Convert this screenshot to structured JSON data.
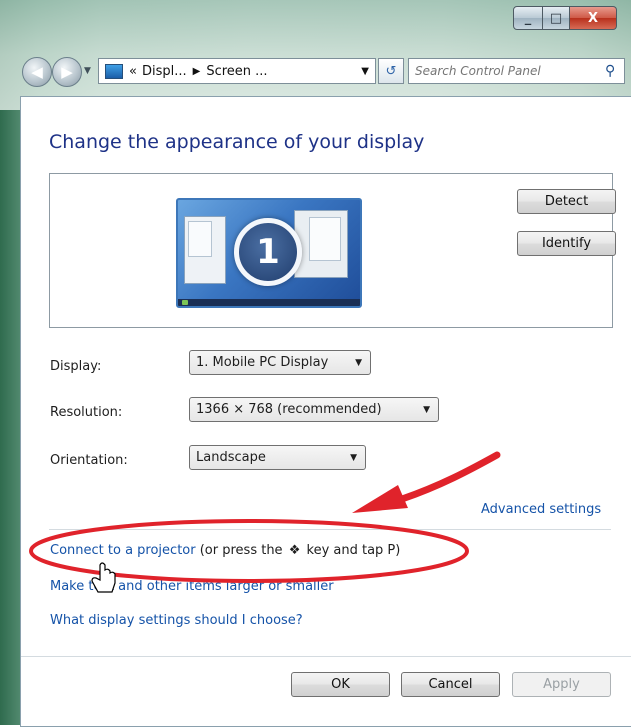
{
  "window": {
    "minimize": "_",
    "maximize": "□",
    "close": "X"
  },
  "nav": {
    "back_icon": "back-arrow-icon",
    "forward_icon": "forward-arrow-icon",
    "breadcrumb": [
      "Displ...",
      "Screen ..."
    ],
    "breadcrumb_prefix": "«",
    "search_placeholder": "Search Control Panel"
  },
  "main": {
    "heading": "Change the appearance of your display",
    "monitor_number": "1",
    "detect_label": "Detect",
    "identify_label": "Identify",
    "display_label": "Display:",
    "display_value": "1. Mobile PC Display",
    "resolution_label": "Resolution:",
    "resolution_value": "1366 × 768 (recommended)",
    "orientation_label": "Orientation:",
    "orientation_value": "Landscape",
    "advanced_link": "Advanced settings",
    "projector_link": "Connect to a projector",
    "projector_hint_pre": "(or press the",
    "projector_hint_post": "key and tap P)",
    "text_size_link": "Make text and other items larger or smaller",
    "help_link": "What display settings should I choose?"
  },
  "footer": {
    "ok": "OK",
    "cancel": "Cancel",
    "apply": "Apply"
  },
  "colors": {
    "heading": "#1e3287",
    "link": "#1553a8",
    "annotation": "#e0232b"
  }
}
